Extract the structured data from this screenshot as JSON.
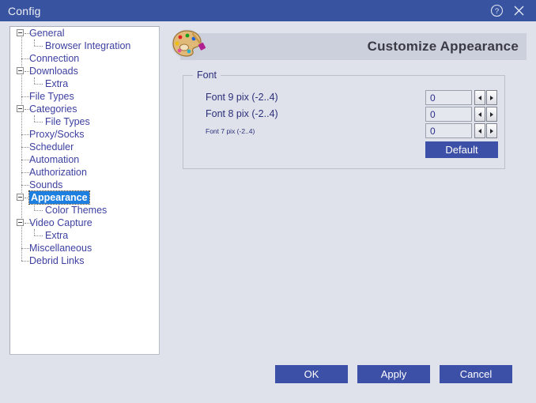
{
  "window": {
    "title": "Config",
    "help_icon": "question-circle-icon",
    "close_icon": "close-icon",
    "accent_blue": "#38539f",
    "background": "#dfe2ea"
  },
  "tree": {
    "selected": "Appearance",
    "selection_color": "#1d7fe0",
    "items": [
      {
        "label": "General",
        "level": 0,
        "expander": "minus"
      },
      {
        "label": "Browser Integration",
        "level": 1,
        "expander": "none"
      },
      {
        "label": "Connection",
        "level": 0,
        "expander": "none"
      },
      {
        "label": "Downloads",
        "level": 0,
        "expander": "minus"
      },
      {
        "label": "Extra",
        "level": 1,
        "expander": "none"
      },
      {
        "label": "File Types",
        "level": 0,
        "expander": "none"
      },
      {
        "label": "Categories",
        "level": 0,
        "expander": "minus"
      },
      {
        "label": "File Types",
        "level": 1,
        "expander": "none"
      },
      {
        "label": "Proxy/Socks",
        "level": 0,
        "expander": "none"
      },
      {
        "label": "Scheduler",
        "level": 0,
        "expander": "none"
      },
      {
        "label": "Automation",
        "level": 0,
        "expander": "none"
      },
      {
        "label": "Authorization",
        "level": 0,
        "expander": "none"
      },
      {
        "label": "Sounds",
        "level": 0,
        "expander": "none"
      },
      {
        "label": "Appearance",
        "level": 0,
        "expander": "minus",
        "selected": true
      },
      {
        "label": "Color Themes",
        "level": 1,
        "expander": "none"
      },
      {
        "label": "Video Capture",
        "level": 0,
        "expander": "minus"
      },
      {
        "label": "Extra",
        "level": 1,
        "expander": "none"
      },
      {
        "label": "Miscellaneous",
        "level": 0,
        "expander": "none"
      },
      {
        "label": "Debrid Links",
        "level": 0,
        "expander": "none"
      }
    ]
  },
  "content": {
    "header_title": "Customize Appearance",
    "header_icon": "palette-icon",
    "font_group": {
      "legend": "Font",
      "rows": [
        {
          "label": "Font 9 pix (-2..4)",
          "value": "0",
          "size": "normal"
        },
        {
          "label": "Font 8 pix (-2..4)",
          "value": "0",
          "size": "normal"
        },
        {
          "label": "Font 7 pix (-2..4)",
          "value": "0",
          "size": "small"
        }
      ],
      "default_label": "Default"
    }
  },
  "footer": {
    "ok_label": "OK",
    "apply_label": "Apply",
    "cancel_label": "Cancel",
    "button_color": "#3c50a8"
  }
}
